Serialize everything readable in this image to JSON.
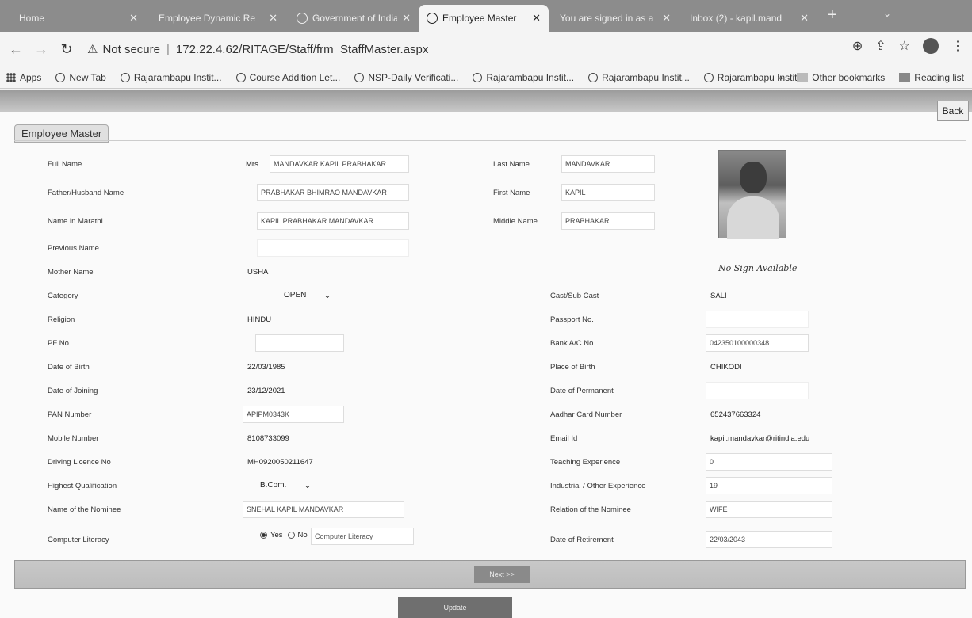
{
  "browser": {
    "tabs": [
      {
        "label": "Home"
      },
      {
        "label": "Employee Dynamic Re"
      },
      {
        "label": "Government of India"
      },
      {
        "label": "Employee Master"
      },
      {
        "label": "You are signed in as a"
      },
      {
        "label": "Inbox (2) - kapil.mand"
      }
    ],
    "new_tab": "+",
    "url_warning": "Not secure",
    "url": "172.22.4.62/RITAGE/Staff/frm_StaffMaster.aspx"
  },
  "bookmarks": {
    "items": [
      {
        "label": "Apps"
      },
      {
        "label": "New Tab"
      },
      {
        "label": "Rajarambapu Instit..."
      },
      {
        "label": "Course Addition Let..."
      },
      {
        "label": "NSP-Daily Verificati..."
      },
      {
        "label": "Rajarambapu Instit..."
      },
      {
        "label": "Rajarambapu Instit..."
      },
      {
        "label": "Rajarambapu Instit..."
      }
    ],
    "overflow": "»",
    "other": "Other bookmarks",
    "reading_list": "Reading list"
  },
  "page": {
    "back": "Back",
    "legend": "Employee Master",
    "fields": {
      "full_name_label": "Full Name",
      "full_name_prefix": "Mrs.",
      "full_name": "MANDAVKAR KAPIL PRABHAKAR",
      "last_name_label": "Last Name",
      "last_name": "MANDAVKAR",
      "father_label": "Father/Husband Name",
      "father": "PRABHAKAR BHIMRAO MANDAVKAR",
      "first_name_label": "First Name",
      "first_name": "KAPIL",
      "marathi_label": "Name in Marathi",
      "marathi": "KAPIL PRABHAKAR MANDAVKAR",
      "middle_name_label": "Middle Name",
      "middle_name": "PRABHAKAR",
      "previous_label": "Previous Name",
      "mother_label": "Mother Name",
      "mother": "USHA",
      "category_label": "Category",
      "category": "OPEN",
      "cast_label": "Cast/Sub Cast",
      "cast": "SALI",
      "religion_label": "Religion",
      "religion": "HINDU",
      "passport_label": "Passport No.",
      "pf_label": "PF No .",
      "bank_label": "Bank A/C No",
      "bank": "042350100000348",
      "dob_label": "Date of Birth",
      "dob": "22/03/1985",
      "pob_label": "Place of Birth",
      "pob": "CHIKODI",
      "doj_label": "Date of Joining",
      "doj": "23/12/2021",
      "dop_label": "Date of Permanent",
      "pan_label": "PAN Number",
      "pan": "APIPM0343K",
      "aadhar_label": "Aadhar Card Number",
      "aadhar": "652437663324",
      "mobile_label": "Mobile Number",
      "mobile": "8108733099",
      "email_label": "Email Id",
      "email": "kapil.mandavkar@ritindia.edu",
      "dl_label": "Driving Licence No",
      "dl": "MH0920050211647",
      "teaching_label": "Teaching Experience",
      "teaching": "0",
      "qual_label": "Highest Qualification",
      "qual": "B.Com.",
      "industrial_label": "Industrial / Other Experience",
      "industrial": "19",
      "nominee_label": "Name of the Nominee",
      "nominee": "SNEHAL KAPIL MANDAVKAR",
      "relation_label": "Relation of the Nominee",
      "relation": "WIFE",
      "computer_label": "Computer Literacy",
      "yes": "Yes",
      "no": "No",
      "computer_placeholder": "Computer Literacy",
      "retirement_label": "Date of Retirement",
      "retirement": "22/03/2043"
    },
    "signature": "No Sign Available",
    "next": "Next >>",
    "update": "Update"
  }
}
